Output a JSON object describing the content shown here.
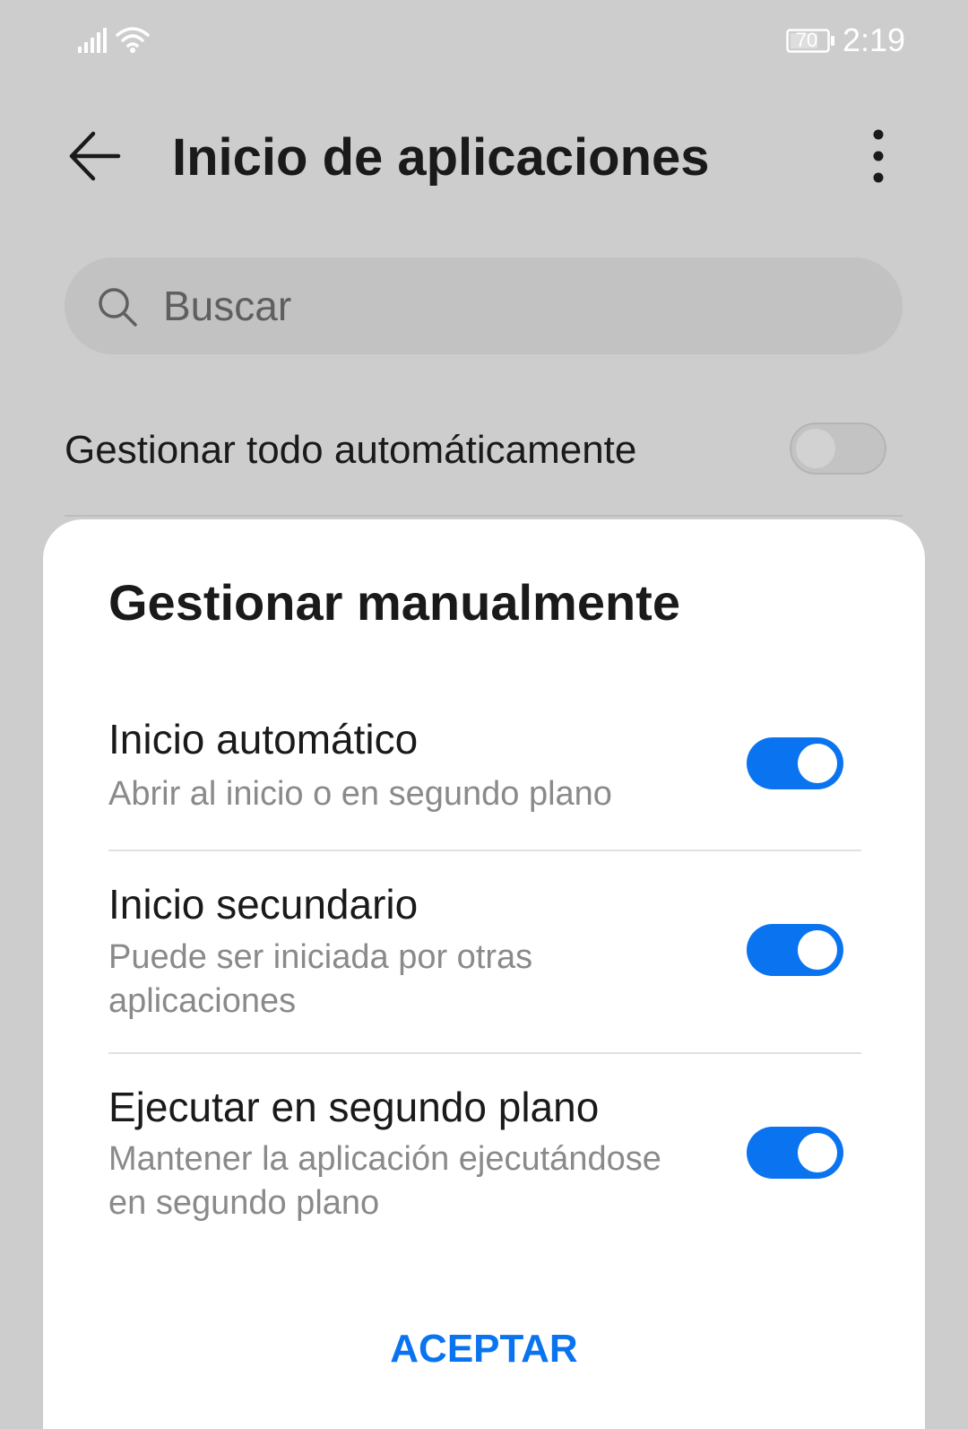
{
  "status_bar": {
    "signal_icon": "signal-bars-icon",
    "wifi_icon": "wifi-icon",
    "battery_level": "70",
    "time": "2:19"
  },
  "header": {
    "back_icon": "arrow-left-icon",
    "title": "Inicio de aplicaciones",
    "more_icon": "more-vertical-icon"
  },
  "search": {
    "icon": "search-icon",
    "placeholder": "Buscar"
  },
  "auto_manage": {
    "label": "Gestionar todo automáticamente",
    "enabled": false
  },
  "dialog": {
    "title": "Gestionar manualmente",
    "options": [
      {
        "title": "Inicio automático",
        "description": "Abrir al inicio o en segundo plano",
        "enabled": true
      },
      {
        "title": "Inicio secundario",
        "description": "Puede ser iniciada por otras aplicaciones",
        "enabled": true
      },
      {
        "title": "Ejecutar en segundo plano",
        "description": "Mantener la aplicación ejecutándose en segundo plano",
        "enabled": true
      }
    ],
    "accept_label": "ACEPTAR"
  },
  "colors": {
    "accent": "#0a74f0",
    "background": "#cdcdcd",
    "dialog_background": "#ffffff"
  }
}
